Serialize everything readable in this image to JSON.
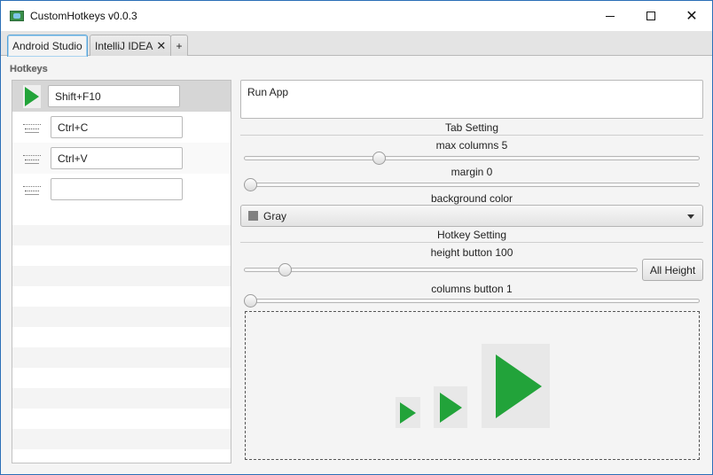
{
  "window": {
    "title": "CustomHotkeys v0.0.3",
    "controls": {
      "minimize": "minimize",
      "maximize": "maximize",
      "close": "✕"
    }
  },
  "tabs": [
    {
      "label": "Android Studio",
      "active": true
    },
    {
      "label": "IntelliJ IDEA",
      "closable": true,
      "close_glyph": "✕"
    },
    {
      "label": "+"
    }
  ],
  "left": {
    "section_label": "Hotkeys",
    "hotkeys": [
      {
        "icon": "play-icon",
        "value": "Shift+F10",
        "selected": true
      },
      {
        "icon": "copy-icon",
        "value": "Ctrl+C"
      },
      {
        "icon": "paste-icon",
        "value": "Ctrl+V"
      },
      {
        "icon": "blank-icon",
        "value": ""
      }
    ]
  },
  "right": {
    "description": "Run App",
    "tab_setting": {
      "title": "Tab Setting",
      "max_columns_label": "max columns 5",
      "max_columns": 5,
      "max_columns_slider_fraction": 0.29,
      "margin_label": "margin 0",
      "margin": 0,
      "margin_slider_fraction": 0.0,
      "background_color_label": "background color",
      "background_color_value": "Gray",
      "background_color_hex": "#808080"
    },
    "hotkey_setting": {
      "title": "Hotkey Setting",
      "height_button_label": "height button 100",
      "height_button": 100,
      "height_slider_fraction": 0.09,
      "all_height_button": "All Height",
      "columns_button_label": "columns button 1",
      "columns_button": 1,
      "columns_slider_fraction": 0.0
    }
  },
  "colors": {
    "accent_play": "#23a43a",
    "tab_focus": "#58a4d8"
  }
}
